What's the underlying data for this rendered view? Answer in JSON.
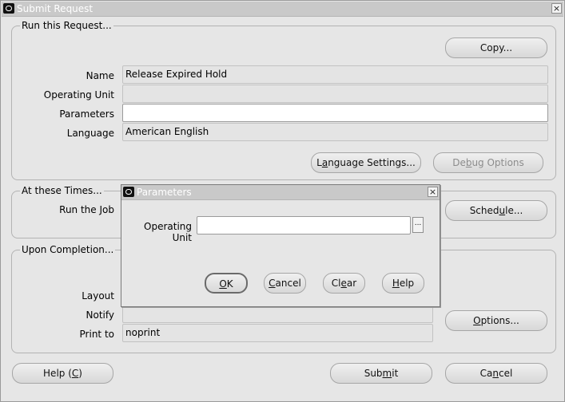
{
  "window": {
    "title": "Submit Request",
    "close_symbol": "×"
  },
  "run_group": {
    "label": "Run this Request...",
    "copy_button": "Copy...",
    "name_label": "Name",
    "name_value": "Release Expired Hold",
    "operating_unit_label": "Operating Unit",
    "operating_unit_value": "",
    "parameters_label": "Parameters",
    "parameters_value": "",
    "language_label": "Language",
    "language_value": "American English",
    "language_settings_button": {
      "pre": "L",
      "u": "a",
      "post": "nguage Settings..."
    },
    "debug_options_button": {
      "pre": "De",
      "u": "b",
      "post": "ug Options"
    }
  },
  "times_group": {
    "label": "At these Times...",
    "run_job_label": "Run the Job",
    "schedule_button": {
      "pre": "Sched",
      "u": "u",
      "post": "le..."
    }
  },
  "completion_group": {
    "label": "Upon Completion...",
    "layout_label": "Layout",
    "notify_label": "Notify",
    "notify_value": "",
    "print_to_label": "Print to",
    "print_to_value": "noprint",
    "options_button": {
      "pre": "",
      "u": "O",
      "post": "ptions..."
    }
  },
  "footer": {
    "help_button": {
      "pre": "Help (",
      "u": "C",
      "post": ")"
    },
    "submit_button": {
      "pre": "Sub",
      "u": "m",
      "post": "it"
    },
    "cancel_button": {
      "pre": "Ca",
      "u": "n",
      "post": "cel"
    }
  },
  "dialog": {
    "title": "Parameters",
    "close_symbol": "×",
    "operating_unit_label": "Operating Unit",
    "operating_unit_value": "",
    "lov_symbol": "...",
    "ok_button": {
      "pre": "",
      "u": "O",
      "post": "K"
    },
    "cancel_button": {
      "pre": "",
      "u": "C",
      "post": "ancel"
    },
    "clear_button": {
      "pre": "Cl",
      "u": "e",
      "post": "ar"
    },
    "help_button": {
      "pre": "",
      "u": "H",
      "post": "elp"
    }
  }
}
